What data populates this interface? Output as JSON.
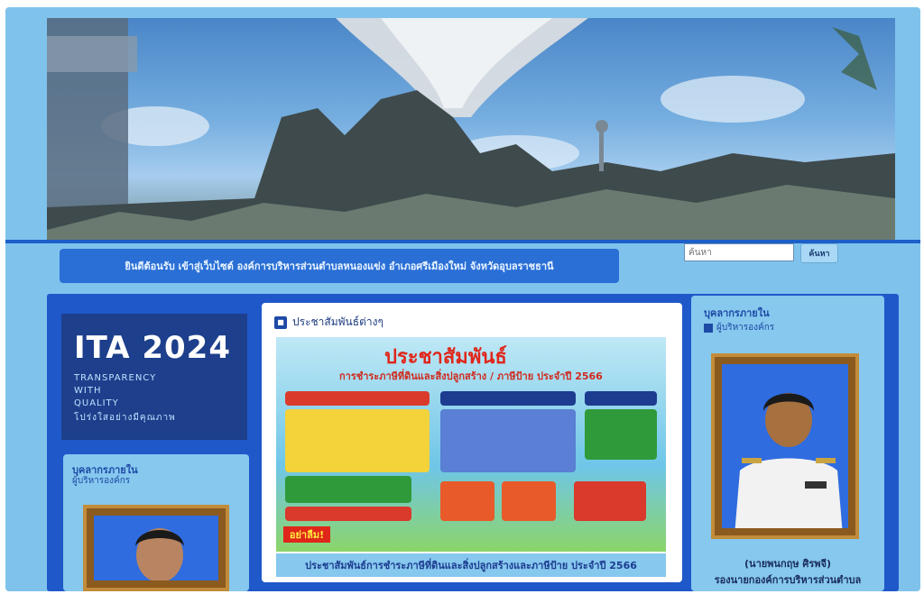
{
  "header": {
    "welcome_text": "ยินดีต้อนรับ เข้าสู่เว็บไซต์ องค์การบริหารส่วนตำบลหนองแข่ง อำเภอศรีเมืองใหม่ จังหวัดอุบลราชธานี"
  },
  "search": {
    "placeholder": "ค้นหา",
    "button_label": "ค้นหา"
  },
  "ita_banner": {
    "title": "ITA 2024",
    "line1": "TRANSPARENCY",
    "line2": "WITH",
    "line3": "QUALITY",
    "thai_line": "โปร่งใสอย่างมีคุณภาพ"
  },
  "left_card": {
    "heading": "บุคลากรภายใน",
    "subheading": "ผู้บริหารองค์กร"
  },
  "news": {
    "section_title": "ประชาสัมพันธ์ต่างๆ",
    "poster_title": "ประชาสัมพันธ์",
    "poster_subtitle": "การชำระภาษีที่ดินและสิ่งปลูกสร้าง / ภาษีป้าย ประจำปี 2566",
    "poster_warning": "อย่าลืม!",
    "caption": "ประชาสัมพันธ์การชำระภาษีที่ดินและสิ่งปลูกสร้างและภาษีป้าย ประจำปี 2566"
  },
  "right_card": {
    "heading": "บุคลากรภายใน",
    "subheading": "ผู้บริหารองค์กร",
    "person_name": "(นายพนกฤษ ศิรพจี)",
    "person_title": "รองนายกองค์การบริหารส่วนตำบล"
  },
  "colors": {
    "page_bg": "#7fc3ec",
    "main_bg": "#1f58c9",
    "accent_red": "#e0261a"
  }
}
